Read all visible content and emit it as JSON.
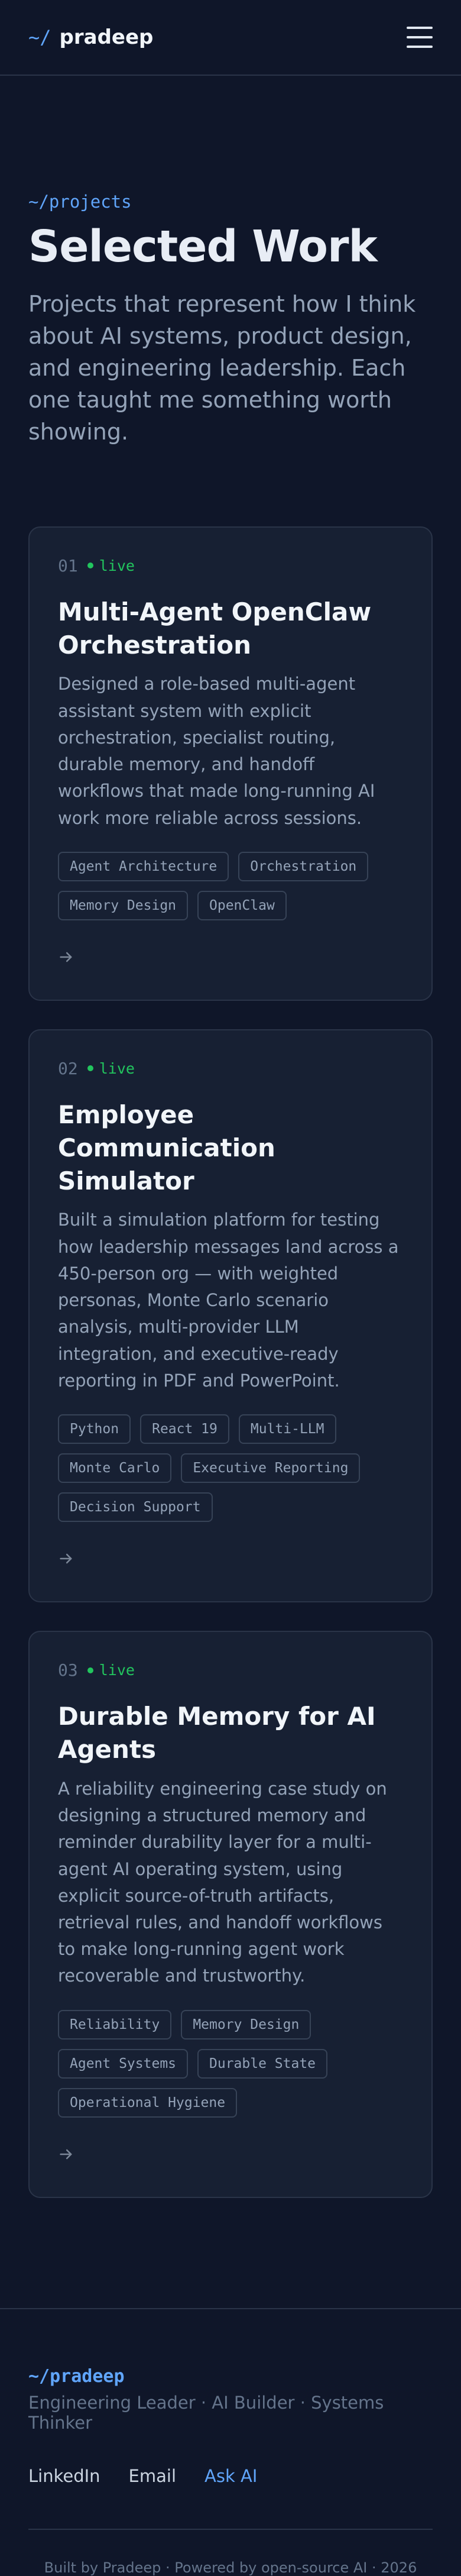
{
  "header": {
    "logo_prefix": "~/",
    "logo_name": "pradeep",
    "menu_icon": "hamburger-menu-icon"
  },
  "hero": {
    "tag": "~/projects",
    "title": "Selected Work",
    "description": "Projects that represent how I think about AI systems, product design, and engineering leadership. Each one taught me something worth showing."
  },
  "projects": [
    {
      "number": "01",
      "status": "live",
      "title": "Multi-Agent OpenClaw Orchestration",
      "description": "Designed a role-based multi-agent assistant system with explicit orchestration, specialist routing, durable memory, and handoff workflows that made long-running AI work more reliable across sessions.",
      "tags": [
        "Agent Architecture",
        "Orchestration",
        "Memory Design",
        "OpenClaw"
      ]
    },
    {
      "number": "02",
      "status": "live",
      "title": "Employee Communication Simulator",
      "description": "Built a simulation platform for testing how leadership messages land across a 450-person org — with weighted personas, Monte Carlo scenario analysis, multi-provider LLM integration, and executive-ready reporting in PDF and PowerPoint.",
      "tags": [
        "Python",
        "React 19",
        "Multi-LLM",
        "Monte Carlo",
        "Executive Reporting",
        "Decision Support"
      ]
    },
    {
      "number": "03",
      "status": "live",
      "title": "Durable Memory for AI Agents",
      "description": "A reliability engineering case study on designing a structured memory and reminder durability layer for a multi-agent AI operating system, using explicit source-of-truth artifacts, retrieval rules, and handoff workflows to make long-running agent work recoverable and trustworthy.",
      "tags": [
        "Reliability",
        "Memory Design",
        "Agent Systems",
        "Durable State",
        "Operational Hygiene"
      ]
    }
  ],
  "footer": {
    "tag": "~/pradeep",
    "subtitle": "Engineering Leader · AI Builder · Systems Thinker",
    "links": [
      "LinkedIn",
      "Email",
      "Ask AI"
    ],
    "copyright": "Built by Pradeep · Powered by open-source AI · 2026"
  },
  "colors": {
    "background": "#0f1629",
    "card": "#172033",
    "accent": "#60a5fa",
    "live": "#22c55e"
  }
}
